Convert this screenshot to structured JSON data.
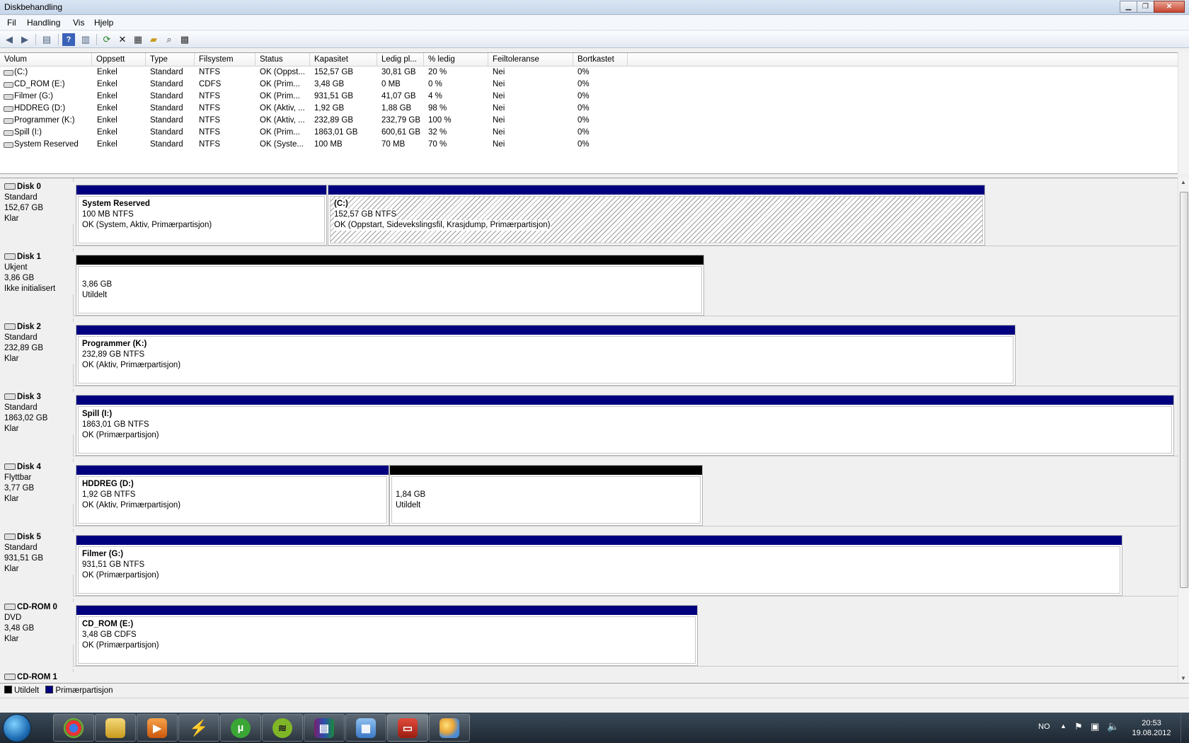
{
  "window": {
    "title": "Diskbehandling",
    "controls": [
      "minimize-icon",
      "maximize-icon",
      "close-icon"
    ]
  },
  "menu": [
    "Fil",
    "Handling",
    "Vis",
    "Hjelp"
  ],
  "toolbar": [
    "back-icon",
    "forward-icon",
    "console-tree-icon",
    "help-icon",
    "action-pane-icon",
    "refresh-icon",
    "delete-icon",
    "properties-icon",
    "open-icon",
    "explore-icon",
    "settings-icon"
  ],
  "volume_list": {
    "columns": [
      "Volum",
      "Oppsett",
      "Type",
      "Filsystem",
      "Status",
      "Kapasitet",
      "Ledig pl...",
      "% ledig",
      "Feiltoleranse",
      "Bortkastet"
    ],
    "rows": [
      [
        "(C:)",
        "Enkel",
        "Standard",
        "NTFS",
        "OK (Oppst...",
        "152,57 GB",
        "30,81 GB",
        "20 %",
        "Nei",
        "0%"
      ],
      [
        "CD_ROM (E:)",
        "Enkel",
        "Standard",
        "CDFS",
        "OK (Prim...",
        "3,48 GB",
        "0 MB",
        "0 %",
        "Nei",
        "0%"
      ],
      [
        "Filmer (G:)",
        "Enkel",
        "Standard",
        "NTFS",
        "OK (Prim...",
        "931,51 GB",
        "41,07 GB",
        "4 %",
        "Nei",
        "0%"
      ],
      [
        "HDDREG (D:)",
        "Enkel",
        "Standard",
        "NTFS",
        "OK (Aktiv, ...",
        "1,92 GB",
        "1,88 GB",
        "98 %",
        "Nei",
        "0%"
      ],
      [
        "Programmer (K:)",
        "Enkel",
        "Standard",
        "NTFS",
        "OK (Aktiv, ...",
        "232,89 GB",
        "232,79 GB",
        "100 %",
        "Nei",
        "0%"
      ],
      [
        "Spill (I:)",
        "Enkel",
        "Standard",
        "NTFS",
        "OK (Prim...",
        "1863,01 GB",
        "600,61 GB",
        "32 %",
        "Nei",
        "0%"
      ],
      [
        "System Reserved",
        "Enkel",
        "Standard",
        "NTFS",
        "OK (Syste...",
        "100 MB",
        "70 MB",
        "70 %",
        "Nei",
        "0%"
      ]
    ]
  },
  "disks": [
    {
      "name": "Disk 0",
      "type": "Standard",
      "size": "152,67 GB",
      "state": "Klar",
      "partitions": [
        {
          "name": "System Reserved",
          "size": "100 MB NTFS",
          "status": "OK (System, Aktiv, Primærpartisjon)",
          "kind": "primary"
        },
        {
          "name": "(C:)",
          "size": "152,57 GB NTFS",
          "status": "OK (Oppstart, Sidevekslingsfil, Krasjdump, Primærpartisjon)",
          "kind": "primary"
        }
      ]
    },
    {
      "name": "Disk 1",
      "type": "Ukjent",
      "size": "3,86 GB",
      "state": "Ikke initialisert",
      "partitions": [
        {
          "name": "",
          "size": "3,86 GB",
          "status": "Utildelt",
          "kind": "unallocated"
        }
      ]
    },
    {
      "name": "Disk 2",
      "type": "Standard",
      "size": "232,89 GB",
      "state": "Klar",
      "partitions": [
        {
          "name": "Programmer  (K:)",
          "size": "232,89 GB NTFS",
          "status": "OK (Aktiv, Primærpartisjon)",
          "kind": "primary"
        }
      ]
    },
    {
      "name": "Disk 3",
      "type": "Standard",
      "size": "1863,02 GB",
      "state": "Klar",
      "partitions": [
        {
          "name": "Spill  (I:)",
          "size": "1863,01 GB NTFS",
          "status": "OK (Primærpartisjon)",
          "kind": "primary"
        }
      ]
    },
    {
      "name": "Disk 4",
      "type": "Flyttbar",
      "size": "3,77 GB",
      "state": "Klar",
      "partitions": [
        {
          "name": "HDDREG  (D:)",
          "size": "1,92 GB NTFS",
          "status": "OK (Aktiv, Primærpartisjon)",
          "kind": "primary"
        },
        {
          "name": "",
          "size": "1,84 GB",
          "status": "Utildelt",
          "kind": "unallocated"
        }
      ]
    },
    {
      "name": "Disk 5",
      "type": "Standard",
      "size": "931,51 GB",
      "state": "Klar",
      "partitions": [
        {
          "name": "Filmer  (G:)",
          "size": "931,51 GB NTFS",
          "status": "OK (Primærpartisjon)",
          "kind": "primary"
        }
      ]
    },
    {
      "name": "CD-ROM 0",
      "type": "DVD",
      "size": "3,48 GB",
      "state": "Klar",
      "partitions": [
        {
          "name": "CD_ROM  (E:)",
          "size": "3,48 GB CDFS",
          "status": "OK (Primærpartisjon)",
          "kind": "primary"
        }
      ]
    },
    {
      "name": "CD-ROM 1",
      "type": "",
      "size": "",
      "state": "",
      "partitions": []
    }
  ],
  "legend": {
    "unallocated": "Utildelt",
    "primary": "Primærpartisjon"
  },
  "colors": {
    "primary": "#00007f",
    "unallocated": "#000000",
    "titlebar": "#c6d6ea"
  },
  "taskbar": {
    "apps": [
      "chrome-icon",
      "explorer-icon",
      "media-player-icon",
      "winamp-icon",
      "utorrent-icon",
      "spotify-icon",
      "winrar-icon",
      "control-panel-icon",
      "toolbox-icon",
      "paint-icon"
    ],
    "tray": {
      "language": "NO",
      "time": "20:53",
      "date": "19.08.2012"
    }
  }
}
